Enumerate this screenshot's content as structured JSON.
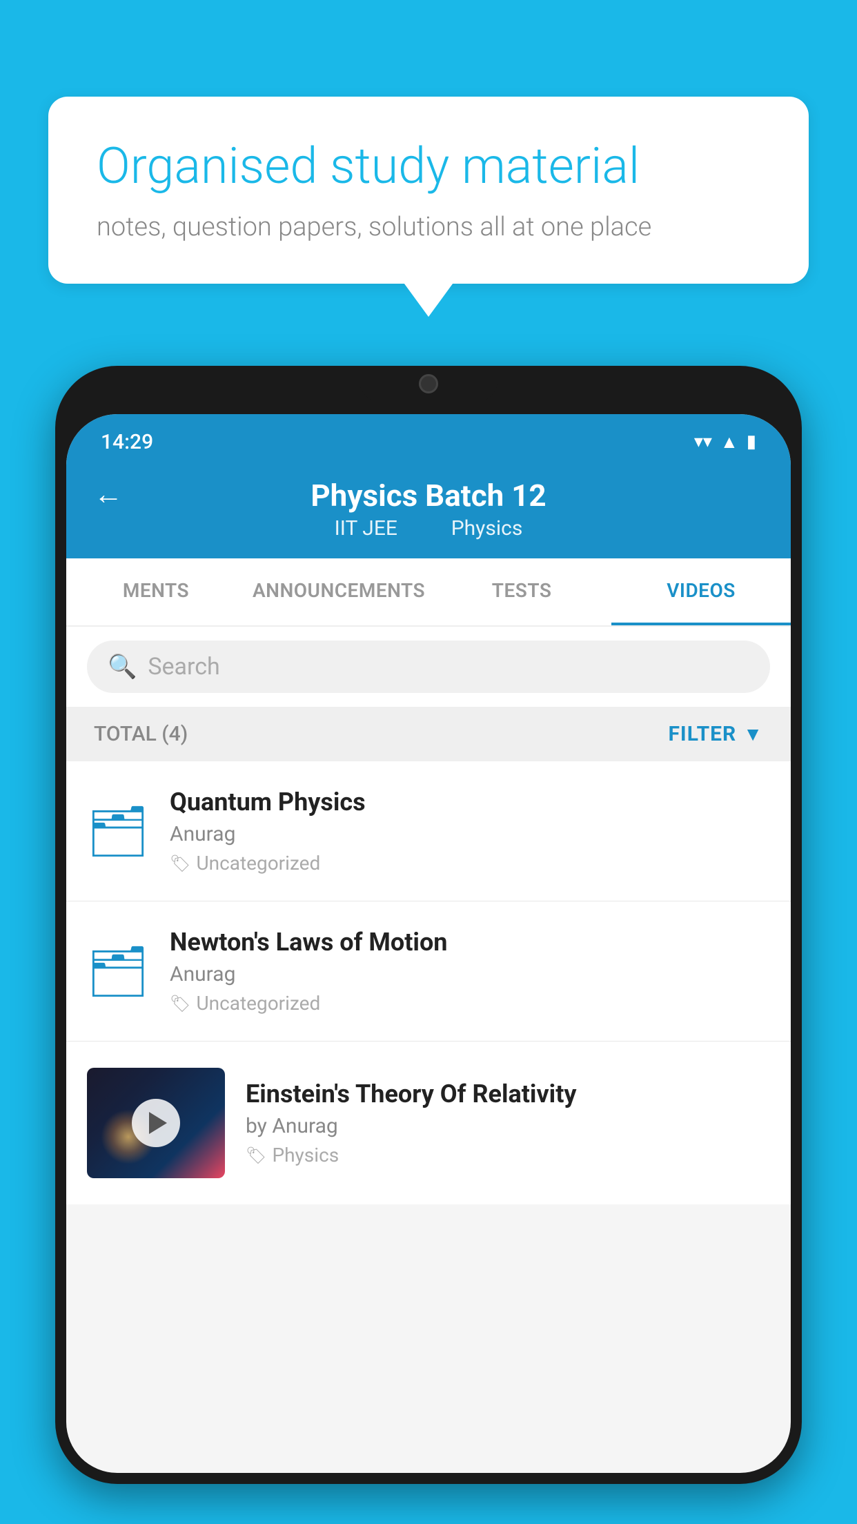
{
  "background_color": "#1ab8e8",
  "speech_bubble": {
    "title": "Organised study material",
    "subtitle": "notes, question papers, solutions all at one place"
  },
  "phone": {
    "status_bar": {
      "time": "14:29",
      "wifi": "▼",
      "signal": "▲",
      "battery": "▮"
    },
    "app_bar": {
      "title": "Physics Batch 12",
      "subtitle_left": "IIT JEE",
      "subtitle_right": "Physics",
      "back_label": "←"
    },
    "tabs": [
      {
        "label": "MENTS",
        "active": false
      },
      {
        "label": "ANNOUNCEMENTS",
        "active": false
      },
      {
        "label": "TESTS",
        "active": false
      },
      {
        "label": "VIDEOS",
        "active": true
      }
    ],
    "search": {
      "placeholder": "Search"
    },
    "filter_bar": {
      "total_label": "TOTAL (4)",
      "filter_label": "FILTER"
    },
    "videos": [
      {
        "id": "quantum-physics",
        "title": "Quantum Physics",
        "author": "Anurag",
        "tag": "Uncategorized",
        "has_thumbnail": false
      },
      {
        "id": "newtons-laws",
        "title": "Newton's Laws of Motion",
        "author": "Anurag",
        "tag": "Uncategorized",
        "has_thumbnail": false
      },
      {
        "id": "einstein-relativity",
        "title": "Einstein's Theory Of Relativity",
        "author": "by Anurag",
        "tag": "Physics",
        "has_thumbnail": true
      }
    ]
  }
}
